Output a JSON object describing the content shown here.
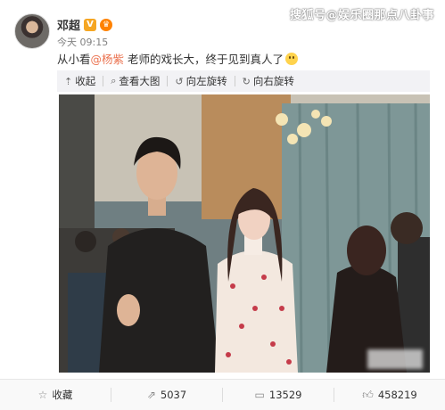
{
  "watermark": "搜狐号@娱乐圈那点八卦事",
  "author": {
    "name": "邓超",
    "verified_mark": "V",
    "member_mark": "♛"
  },
  "timestamp": "今天 09:15",
  "content": {
    "prefix": "从小看",
    "mention": "@杨紫",
    "suffix": " 老师的戏长大，终于见到真人了"
  },
  "toolbar": {
    "collect": {
      "icon": "collapse-up-icon",
      "label": "收起"
    },
    "zoom": {
      "icon": "magnify-icon",
      "label": "查看大图"
    },
    "rotate_left": {
      "icon": "rotate-left-icon",
      "label": "向左旋转"
    },
    "rotate_right": {
      "icon": "rotate-right-icon",
      "label": "向右旋转"
    }
  },
  "actions": {
    "favorite": {
      "icon": "star-icon",
      "label": "收藏"
    },
    "forward": {
      "icon": "share-icon",
      "count": "5037"
    },
    "comment": {
      "icon": "comment-icon",
      "count": "13529"
    },
    "like": {
      "icon": "thumbs-up-icon",
      "count": "458219"
    }
  }
}
